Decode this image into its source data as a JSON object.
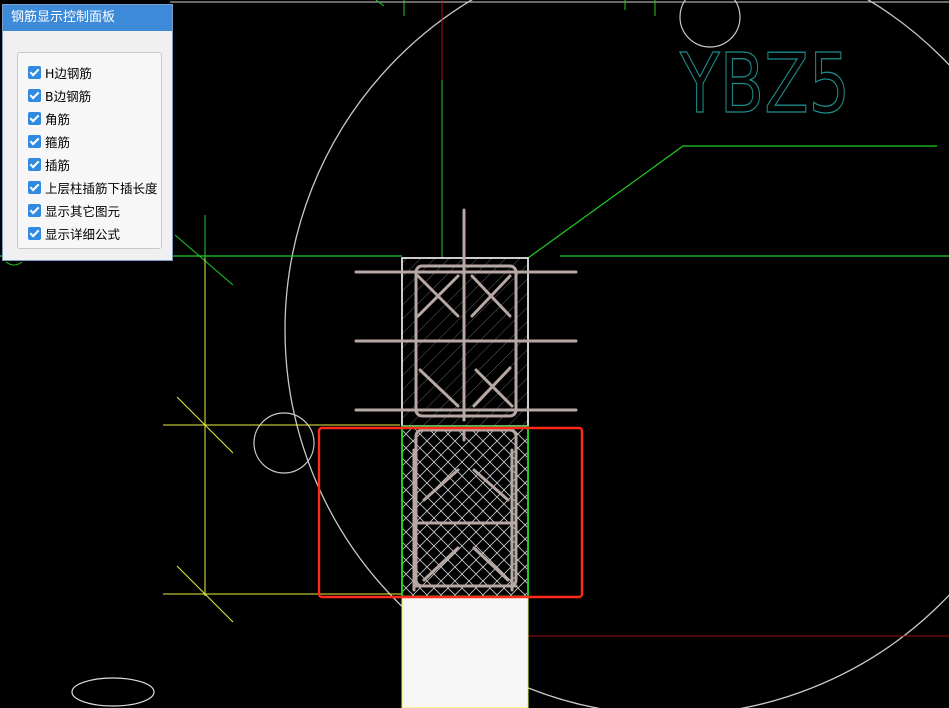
{
  "panel": {
    "title": "钢筋显示控制面板",
    "options": [
      {
        "label": "H边钢筋",
        "checked": true
      },
      {
        "label": "B边钢筋",
        "checked": true
      },
      {
        "label": "角筋",
        "checked": true
      },
      {
        "label": "箍筋",
        "checked": true
      },
      {
        "label": "插筋",
        "checked": true
      },
      {
        "label": "上层柱插筋下插长度",
        "checked": true
      },
      {
        "label": "显示其它图元",
        "checked": true
      },
      {
        "label": "显示详细公式",
        "checked": true
      }
    ]
  },
  "drawing": {
    "label": "YBZ5",
    "colors": {
      "background": "#000000",
      "grid_green": "#22cc22",
      "axis_yellow": "#e8f040",
      "rebar": "#b8a8a4",
      "highlight": "#ff2a1a",
      "label": "#1f8a8a",
      "circle": "#d0d0d0"
    }
  }
}
